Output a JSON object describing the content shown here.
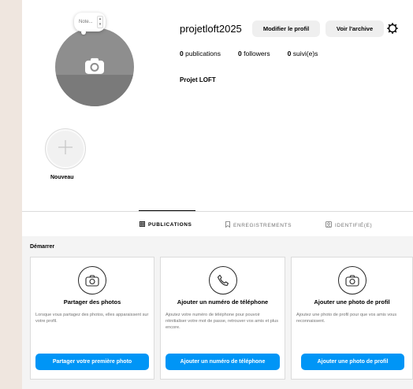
{
  "profile": {
    "username": "projetloft2025",
    "edit_button": "Modifier le profil",
    "archive_button": "Voir l'archive",
    "full_name": "Projet LOFT",
    "note_placeholder": "Note...",
    "stats": [
      {
        "count": "0",
        "label": "publications"
      },
      {
        "count": "0",
        "label": "followers"
      },
      {
        "count": "0",
        "label": "suivi(e)s"
      }
    ]
  },
  "highlights": {
    "new_label": "Nouveau"
  },
  "tabs": [
    {
      "label": "PUBLICATIONS",
      "icon": "grid-icon",
      "active": true
    },
    {
      "label": "ENREGISTREMENTS",
      "icon": "bookmark-icon",
      "active": false
    },
    {
      "label": "IDENTIFIÉ(E)",
      "icon": "tagged-icon",
      "active": false
    }
  ],
  "start": {
    "title": "Démarrer",
    "cards": [
      {
        "icon": "camera-icon",
        "title": "Partager des photos",
        "description": "Lorsque vous partagez des photos, elles apparaissent sur votre profil.",
        "button": "Partager votre première photo"
      },
      {
        "icon": "phone-icon",
        "title": "Ajouter un numéro de téléphone",
        "description": "Ajoutez votre numéro de téléphone pour pouvoir réinitialiser votre mot de passe, retrouver vos amis et plus encore.",
        "button": "Ajouter un numéro de téléphone"
      },
      {
        "icon": "camera-icon",
        "title": "Ajouter une photo de profil",
        "description": "Ajoutez une photo de profil pour que vos amis vous reconnaissent.",
        "button": "Ajouter une photo de profil"
      }
    ]
  },
  "colors": {
    "accent": "#0095f6",
    "background": "#efe6df"
  }
}
